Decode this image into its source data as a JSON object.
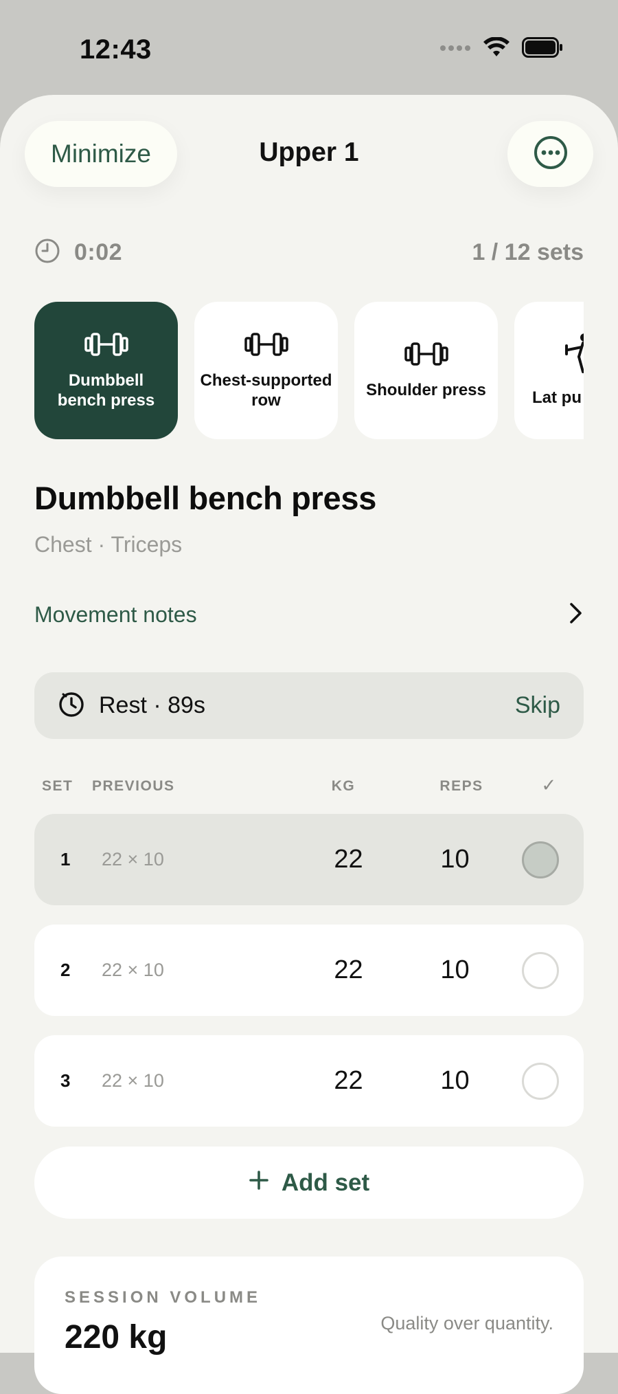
{
  "status_bar": {
    "time": "12:43"
  },
  "header": {
    "minimize_label": "Minimize",
    "title": "Upper 1",
    "more_icon": "ellipsis-circle-icon"
  },
  "progress": {
    "elapsed": "0:02",
    "sets": "1 / 12 sets"
  },
  "exercises": [
    {
      "name": "Dumbbell bench press",
      "icon": "dumbbell-icon",
      "active": true
    },
    {
      "name": "Chest-supported row",
      "icon": "dumbbell-icon",
      "active": false
    },
    {
      "name": "Shoulder press",
      "icon": "dumbbell-icon",
      "active": false
    },
    {
      "name": "Lat pu",
      "icon": "pulldown-figure-icon",
      "active": false
    }
  ],
  "current_exercise": {
    "name": "Dumbbell bench press",
    "muscles": "Chest · Triceps",
    "notes_label": "Movement notes"
  },
  "rest": {
    "text": "Rest · 89s",
    "skip_label": "Skip"
  },
  "table": {
    "headers": {
      "set": "SET",
      "previous": "PREVIOUS",
      "kg": "KG",
      "reps": "REPS",
      "done": "✓"
    },
    "rows": [
      {
        "set": "1",
        "previous": "22 × 10",
        "kg": "22",
        "reps": "10",
        "completed": false,
        "current": true
      },
      {
        "set": "2",
        "previous": "22 × 10",
        "kg": "22",
        "reps": "10",
        "completed": false,
        "current": false
      },
      {
        "set": "3",
        "previous": "22 × 10",
        "kg": "22",
        "reps": "10",
        "completed": false,
        "current": false
      }
    ]
  },
  "add_set_label": "Add set",
  "volume": {
    "label": "SESSION VOLUME",
    "value": "220 kg",
    "note": "Quality over quantity."
  },
  "colors": {
    "accent": "#2e5a47",
    "active_card": "#22463a",
    "background": "#f4f4f0"
  }
}
